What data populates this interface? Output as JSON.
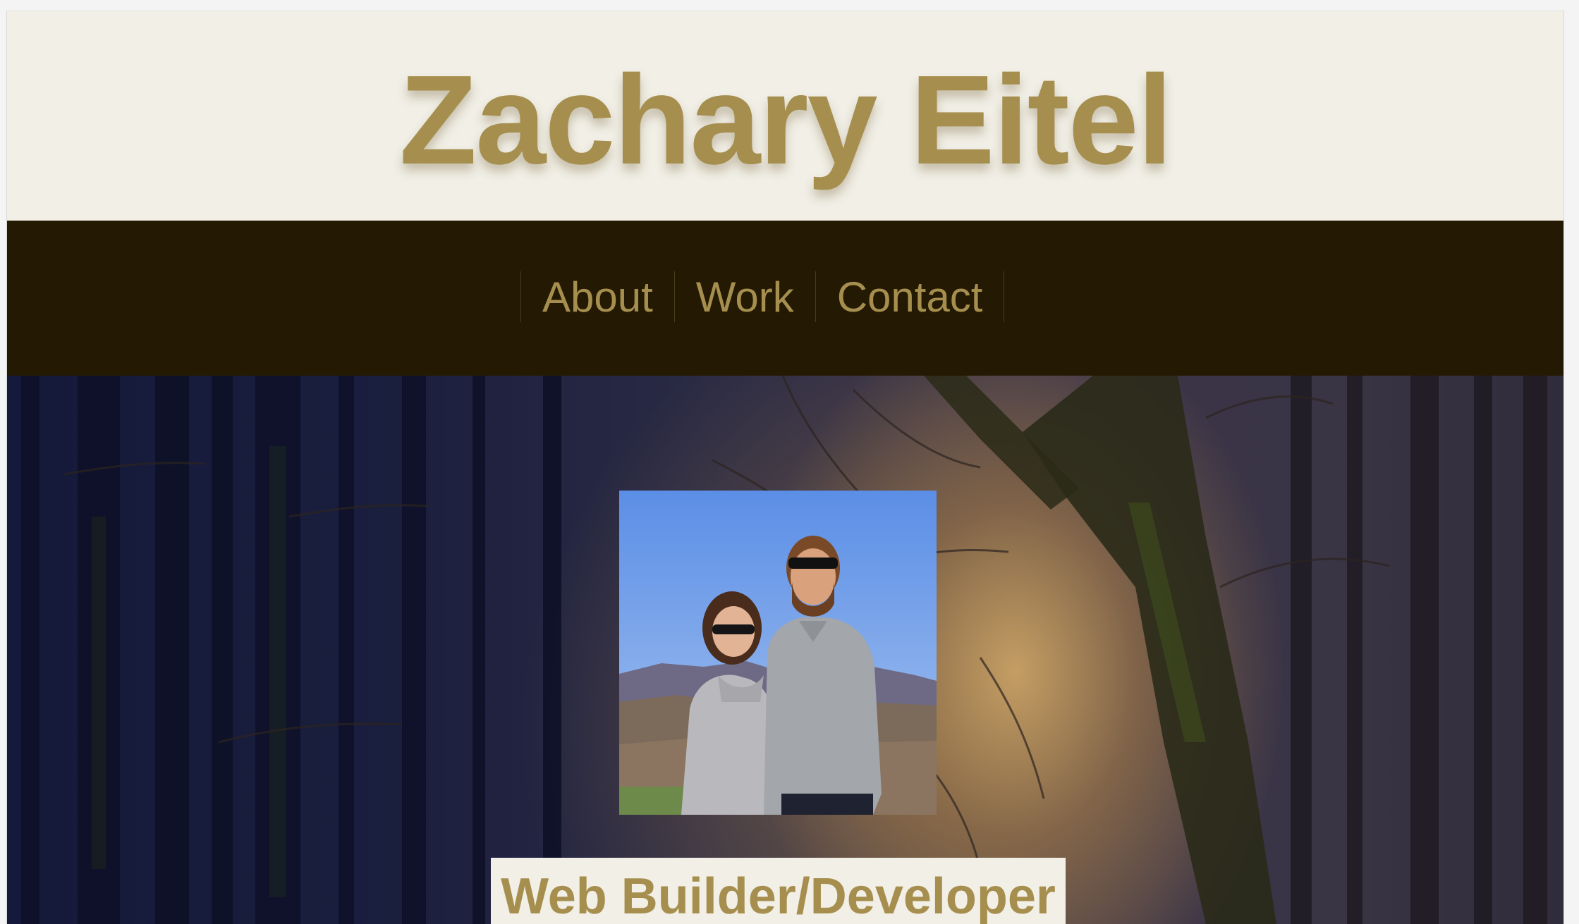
{
  "header": {
    "title": "Zachary Eitel"
  },
  "nav": {
    "items": [
      {
        "label": "About"
      },
      {
        "label": "Work"
      },
      {
        "label": "Contact"
      }
    ]
  },
  "hero": {
    "tagline": "Web Builder/Developer"
  },
  "colors": {
    "accent": "#a68f4e",
    "header_bg": "#f1efe6",
    "nav_bg": "#241a03"
  }
}
